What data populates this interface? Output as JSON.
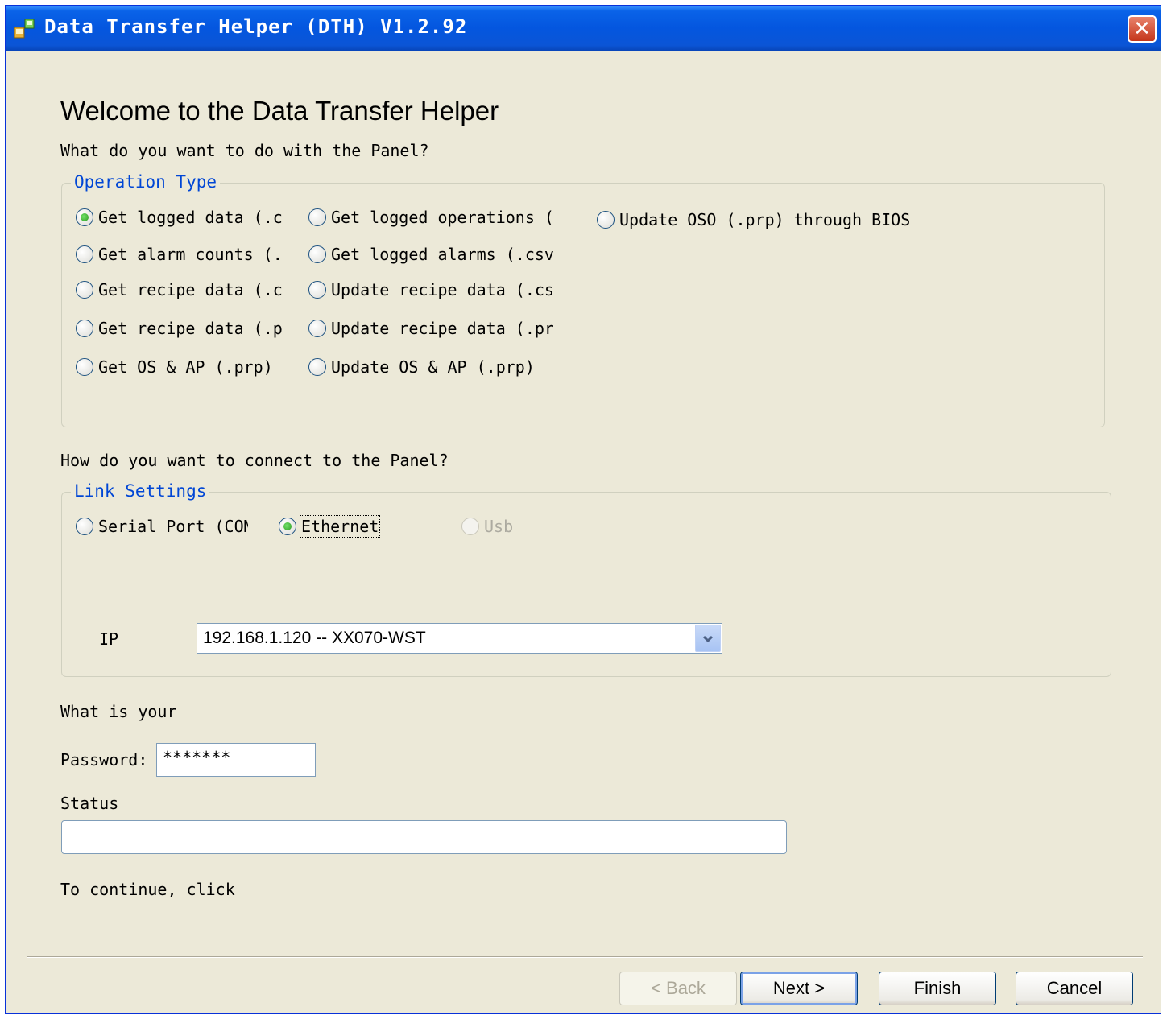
{
  "window": {
    "title": "Data Transfer Helper (DTH) V1.2.92",
    "close_glyph": "✕"
  },
  "heading": "Welcome to the Data Transfer Helper",
  "question_operation": "What do you want to do with the Panel?",
  "operation_group": {
    "legend": "Operation Type",
    "options": [
      {
        "label": "Get logged data (.c",
        "checked": true
      },
      {
        "label": "Get logged operations (",
        "checked": false
      },
      {
        "label": "Update OSO (.prp) through BIOS",
        "checked": false
      },
      {
        "label": "Get alarm counts (.",
        "checked": false
      },
      {
        "label": "Get logged alarms (.csv",
        "checked": false
      },
      {
        "label": "Get recipe data (.c",
        "checked": false
      },
      {
        "label": "Update recipe data (.cs",
        "checked": false
      },
      {
        "label": "Get recipe data (.p",
        "checked": false
      },
      {
        "label": "Update recipe data (.pr",
        "checked": false
      },
      {
        "label": "Get OS & AP (.prp)",
        "checked": false
      },
      {
        "label": "Update OS & AP (.prp)",
        "checked": false
      }
    ]
  },
  "question_connect": "How do you want to connect to the Panel?",
  "link_group": {
    "legend": "Link Settings",
    "options": [
      {
        "label": "Serial Port (COM",
        "checked": false,
        "enabled": true
      },
      {
        "label": "Ethernet",
        "checked": true,
        "enabled": true
      },
      {
        "label": "Usb",
        "checked": false,
        "enabled": false
      }
    ],
    "ip_label": "IP",
    "ip_value": "192.168.1.120 -- XX070-WST"
  },
  "question_password": "What is your",
  "password_label": "Password:",
  "password_value": "*******",
  "status_label": "Status",
  "status_value": "",
  "continue_text": "To continue, click",
  "buttons": {
    "back": "< Back",
    "next": "Next >",
    "finish": "Finish",
    "cancel": "Cancel"
  },
  "icons": {
    "app": "app-icon",
    "close": "close-icon",
    "dropdown": "chevron-down-icon"
  }
}
